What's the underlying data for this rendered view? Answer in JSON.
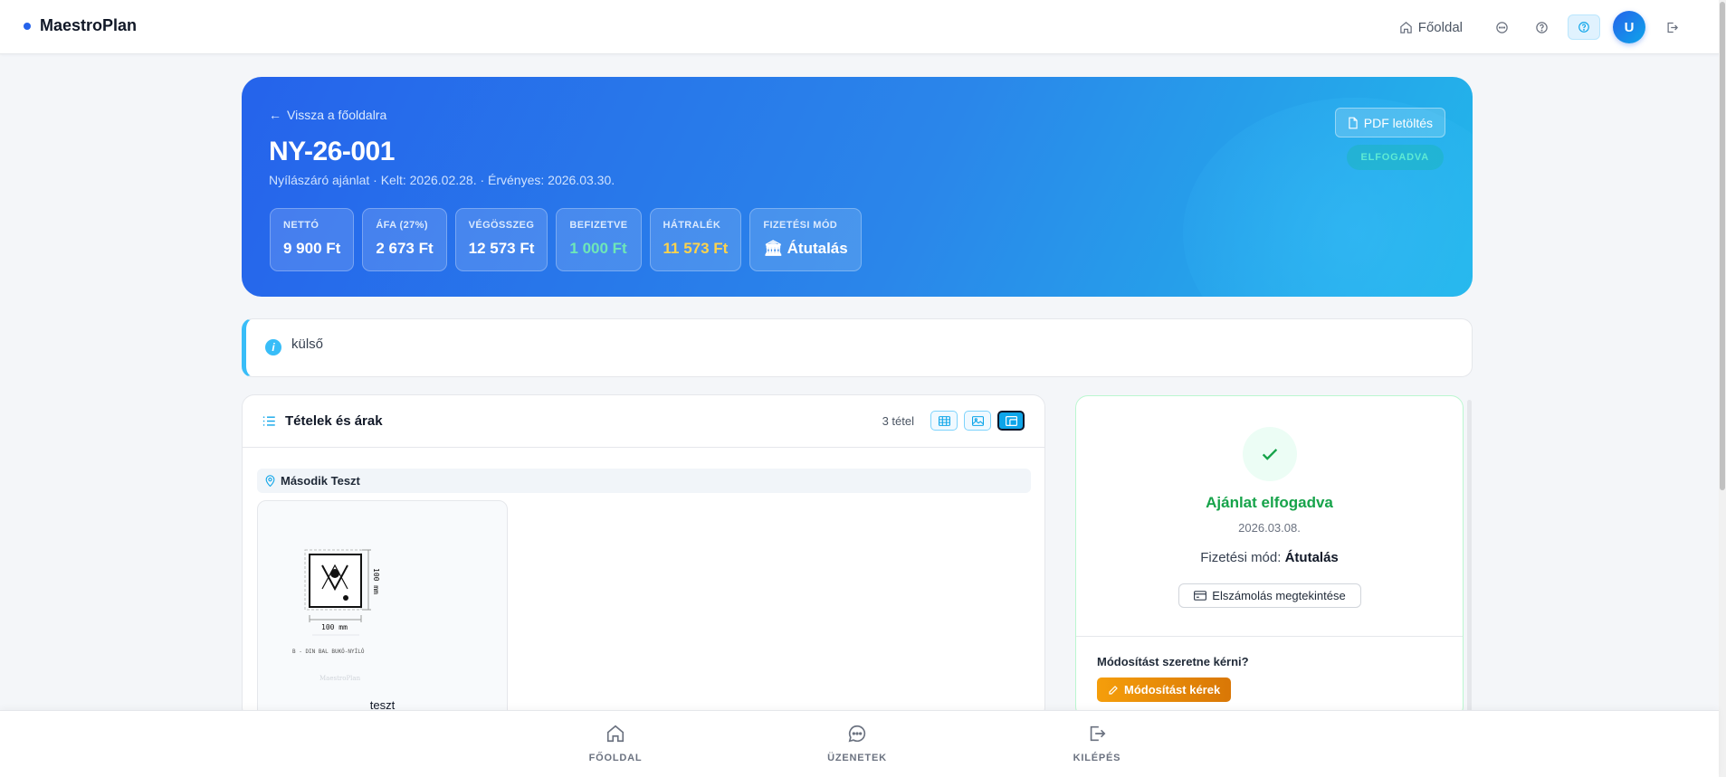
{
  "app": {
    "name": "MaestroPlan"
  },
  "nav": {
    "home_label": "Főoldal",
    "home_icon": "home-icon",
    "icons": [
      "chat-icon",
      "help-icon",
      "help-active-icon",
      "logout-icon"
    ],
    "avatar_initial": "U"
  },
  "offer": {
    "back_label": "Vissza a főoldalra",
    "number": "NY-26-001",
    "subtitle": "Nyílászáró ajánlat · Kelt: 2026.02.28. · Érvényes: 2026.03.30.",
    "pdf_label": "PDF letöltés",
    "status": "ELFOGADVA",
    "stats": [
      {
        "label": "NETTÓ",
        "value": "9 900 Ft"
      },
      {
        "label": "ÁFA (27%)",
        "value": "2 673 Ft"
      },
      {
        "label": "VÉGÖSSZEG",
        "value": "12 573 Ft"
      },
      {
        "label": "BEFIZETVE",
        "value": "1 000 Ft",
        "color": "#6ee7b7"
      },
      {
        "label": "HÁTRALÉK",
        "value": "11 573 Ft",
        "color": "#fcd34d"
      },
      {
        "label": "FIZETÉSI MÓD",
        "value": "🏛 Átutalás"
      }
    ]
  },
  "note": {
    "text": "külső"
  },
  "items": {
    "title": "Tételek és árak",
    "count": "3 tétel",
    "view_modes": [
      "table-view-icon",
      "image-view-icon",
      "card-view-icon"
    ],
    "active_view": "card-view-icon",
    "location": "Második Teszt",
    "tiles": [
      {
        "width_label": "100 mm",
        "height_label": "100 mm",
        "type_label": "B - DIN BAL BUKÓ-NYÍLÓ",
        "watermark": "MaestroPlan",
        "name": "teszt"
      }
    ]
  },
  "status_panel": {
    "title": "Ajánlat elfogadva",
    "date": "2026.03.08.",
    "payment_prefix": "Fizetési mód:",
    "payment_value": "Átutalás",
    "billing_label": "Elszámolás megtekintése",
    "modify_question": "Módosítást szeretne kérni?",
    "modify_label": "Módosítást kérek"
  },
  "bottom_nav": [
    {
      "label": "FŐOLDAL",
      "icon": "home-icon"
    },
    {
      "label": "ÜZENETEK",
      "icon": "chat-icon"
    },
    {
      "label": "KILÉPÉS",
      "icon": "logout-icon"
    }
  ],
  "colors": {
    "accent": "#2563eb",
    "accent_light": "#0ea5e9",
    "success": "#16a34a",
    "warning": "#f59e0b"
  }
}
